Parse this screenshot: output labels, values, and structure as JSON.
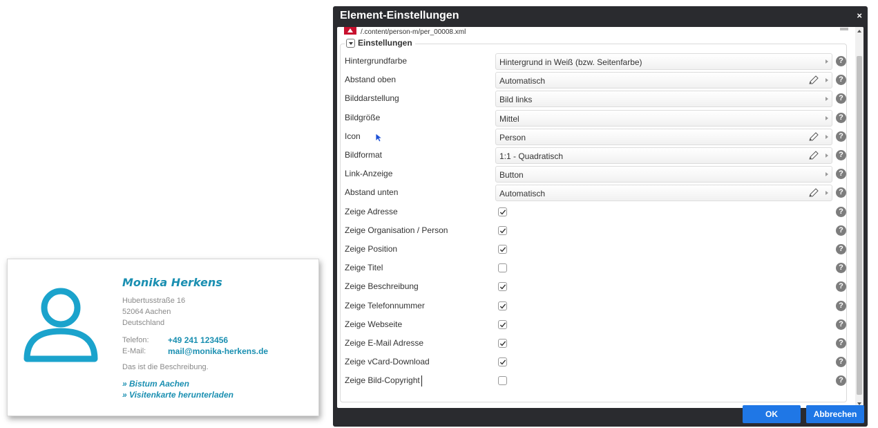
{
  "card": {
    "name": "Monika Herkens",
    "address": [
      "Hubertusstraße 16",
      "52064 Aachen",
      "Deutschland"
    ],
    "phone_label": "Telefon:",
    "phone": "+49 241 123456",
    "email_label": "E-Mail:",
    "email": "mail@monika-herkens.de",
    "description": "Das ist die Beschreibung.",
    "link_org": "» Bistum Aachen",
    "link_vcard": "» Visitenkarte herunterladen",
    "accent_color": "#1a8fb1"
  },
  "dialog": {
    "title": "Element-Einstellungen",
    "close": "×",
    "resource_path": "/.content/person-m/per_00008.xml",
    "section_title": "Einstellungen",
    "rows": [
      {
        "label": "Hintergrundfarbe",
        "value": "Hintergrund in Weiß (bzw. Seitenfarbe)",
        "editable": false
      },
      {
        "label": "Abstand oben",
        "value": "Automatisch",
        "editable": true
      },
      {
        "label": "Bilddarstellung",
        "value": "Bild links",
        "editable": false
      },
      {
        "label": "Bildgröße",
        "value": "Mittel",
        "editable": false
      },
      {
        "label": "Icon",
        "value": "Person",
        "editable": true
      },
      {
        "label": "Bildformat",
        "value": "1:1 - Quadratisch",
        "editable": true
      },
      {
        "label": "Link-Anzeige",
        "value": "Button",
        "editable": false
      },
      {
        "label": "Abstand unten",
        "value": "Automatisch",
        "editable": true
      }
    ],
    "checks": [
      {
        "label": "Zeige Adresse",
        "checked": true
      },
      {
        "label": "Zeige Organisation / Person",
        "checked": true
      },
      {
        "label": "Zeige Position",
        "checked": true
      },
      {
        "label": "Zeige Titel",
        "checked": false
      },
      {
        "label": "Zeige Beschreibung",
        "checked": true
      },
      {
        "label": "Zeige Telefonnummer",
        "checked": true
      },
      {
        "label": "Zeige Webseite",
        "checked": true
      },
      {
        "label": "Zeige E-Mail Adresse",
        "checked": true
      },
      {
        "label": "Zeige vCard-Download",
        "checked": true
      },
      {
        "label": "Zeige Bild-Copyright",
        "checked": false
      }
    ],
    "help_glyph": "?",
    "ok_label": "OK",
    "cancel_label": "Abbrechen",
    "button_color": "#1f77e6"
  }
}
